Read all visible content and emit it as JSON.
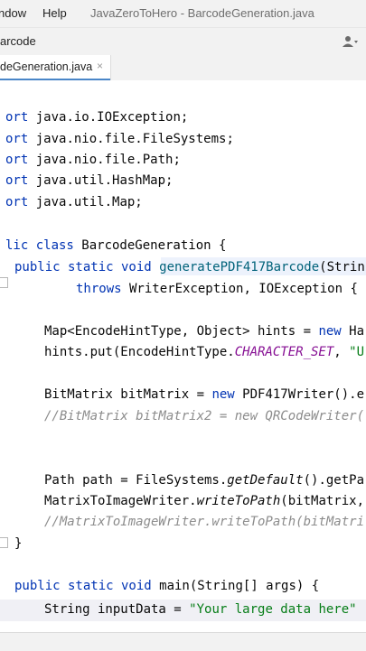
{
  "menubar": {
    "items": [
      "ndow",
      "Help"
    ],
    "window_title": "JavaZeroToHero - BarcodeGeneration.java"
  },
  "navbar": {
    "breadcrumb": "arcode"
  },
  "editor_tab": {
    "label": "deGeneration.java",
    "close": "×"
  },
  "code": {
    "ghost_top": "-----------------------------------------",
    "imports": [
      {
        "kw": "ort",
        "pkg": " java.io.IOException;"
      },
      {
        "kw": "ort",
        "pkg": " java.nio.file.FileSystems;"
      },
      {
        "kw": "ort",
        "pkg": " java.nio.file.Path;"
      },
      {
        "kw": "ort",
        "pkg": " java.util.HashMap;"
      },
      {
        "kw": "ort",
        "pkg": " java.util.Map;"
      }
    ],
    "class_decl": {
      "kw": "lic class",
      "name": " BarcodeGeneration {"
    },
    "method1": {
      "kw": "public static void",
      "name": "generatePDF417Barcode",
      "rest": "(Strin"
    },
    "throws": {
      "kw": "throws",
      "rest": " WriterException, IOException {"
    },
    "hints_decl": {
      "pre": "Map<EncodeHintType, Object> hints = ",
      "kw": "new",
      "post": " Ha"
    },
    "hints_put": {
      "pre": "hints.put(EncodeHintType.",
      "const": "CHARACTER_SET",
      "post": ", ",
      "str": "\"U"
    },
    "bitmatrix": {
      "pre": "BitMatrix bitMatrix = ",
      "kw": "new",
      "post": " PDF417Writer().e"
    },
    "comment1": "//BitMatrix bitMatrix2 = new QRCodeWriter(",
    "path_line": {
      "pre": "Path path = FileSystems.",
      "call": "getDefault",
      "post": "().getPa"
    },
    "writer_line": {
      "pre": "MatrixToImageWriter.",
      "call": "writeToPath",
      "post": "(bitMatrix,"
    },
    "comment2": "//MatrixToImageWriter.writeToPath(bitMatri",
    "close_brace": "}",
    "main_decl": {
      "kw": "public static void",
      "name": " main",
      "rest": "(String[] args) {"
    },
    "input_line": {
      "pre": "String inputData = ",
      "str": "\"Your large data here\""
    }
  }
}
